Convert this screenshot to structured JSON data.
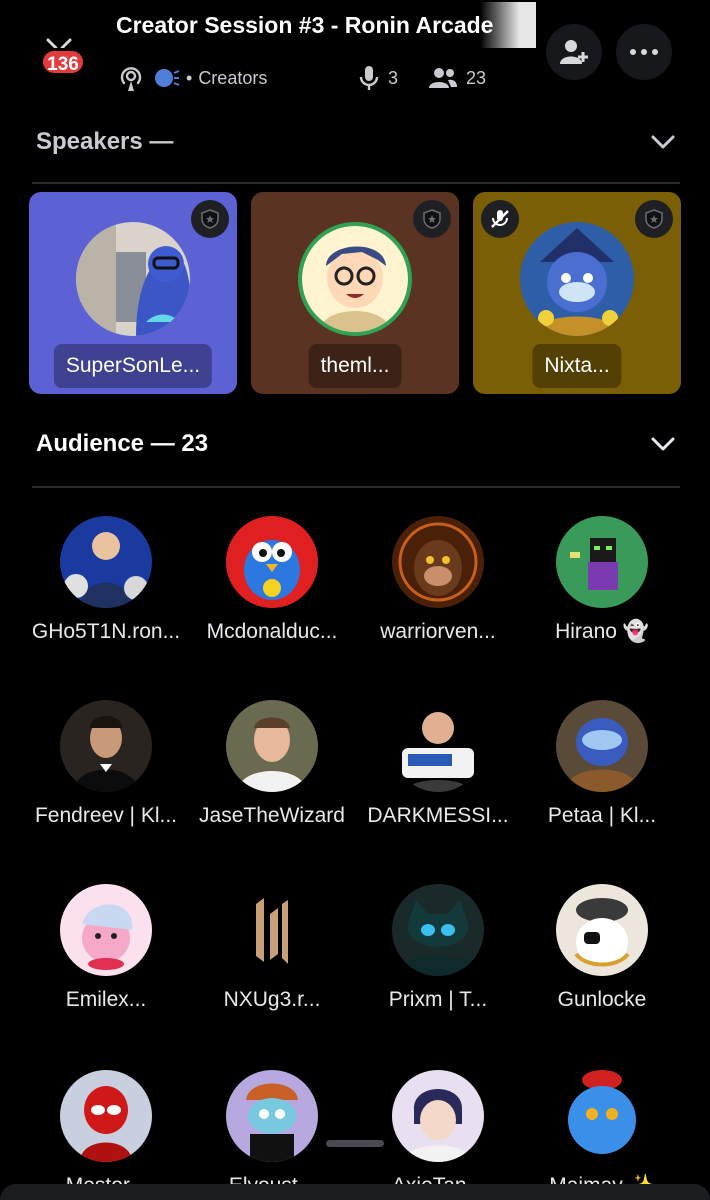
{
  "header": {
    "badge_count": "136",
    "title": "Creator Session #3 - Ronin Arcade",
    "category": "Creators",
    "speaker_count": "3",
    "listener_count": "23"
  },
  "speakers": {
    "heading": "Speakers —",
    "cards": [
      {
        "name": "SuperSonLe...",
        "bg": "#5c62d4"
      },
      {
        "name": "theml...",
        "bg": "#5a3322"
      },
      {
        "name": "Nixta...",
        "bg": "#7a5f06"
      }
    ]
  },
  "audience": {
    "heading": "Audience — 23",
    "members": [
      {
        "name": "GHo5T1N.ron..."
      },
      {
        "name": "Mcdonalduc..."
      },
      {
        "name": "warriorven..."
      },
      {
        "name": "Hirano 👻"
      },
      {
        "name": "Fendreev | Kl..."
      },
      {
        "name": "JaseTheWizard"
      },
      {
        "name": "DARKMESSI..."
      },
      {
        "name": "Petaa | Kl..."
      },
      {
        "name": "Emilex..."
      },
      {
        "name": "NXUg3.r..."
      },
      {
        "name": "Prixm | T..."
      },
      {
        "name": "Gunlocke"
      },
      {
        "name": "Mestor..."
      },
      {
        "name": "Elyoust..."
      },
      {
        "name": "AxieTan..."
      },
      {
        "name": "Maimay ✨"
      }
    ]
  },
  "colors": {
    "background": "#000000",
    "badge": "#e23b3b",
    "muted_text": "#c9cbd0"
  }
}
